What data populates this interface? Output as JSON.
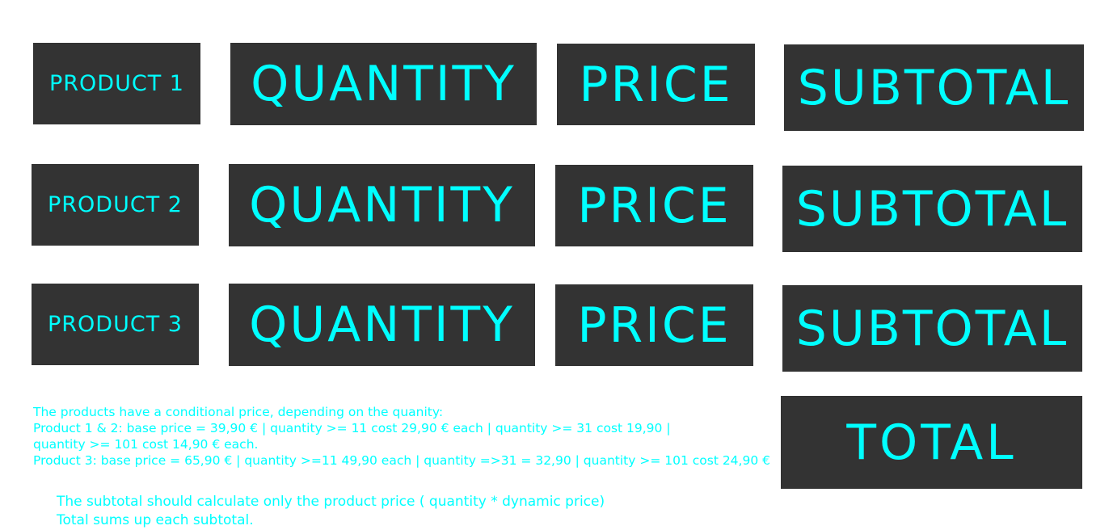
{
  "rows": [
    {
      "product": "PRODUCT 1",
      "quantity": "QUANTITY",
      "price": "PRICE",
      "subtotal": "SUBTOTAL"
    },
    {
      "product": "PRODUCT 2",
      "quantity": "QUANTITY",
      "price": "PRICE",
      "subtotal": "SUBTOTAL"
    },
    {
      "product": "PRODUCT 3",
      "quantity": "QUANTITY",
      "price": "PRICE",
      "subtotal": "SUBTOTAL"
    }
  ],
  "total_label": "TOTAL",
  "notes": [
    "The products have a conditional price, depending on the quanity:",
    "Product 1 & 2: base price = 39,90 € | quantity >= 11 cost 29,90 € each | quantity >= 31 cost 19,90 |",
    "quantity >= 101 cost 14,90 € each.",
    "Product 3: base price = 65,90 € | quantity >=11 49,90 each | quantity =>31 = 32,90 | quantity >= 101 cost 24,90 €"
  ],
  "footer_notes": [
    "The subtotal should calculate only the product price ( quantity * dynamic price)",
    "Total sums up each subtotal."
  ],
  "colors": {
    "box_bg": "#333333",
    "text_accent": "#00ffff",
    "page_bg": "#ffffff"
  }
}
